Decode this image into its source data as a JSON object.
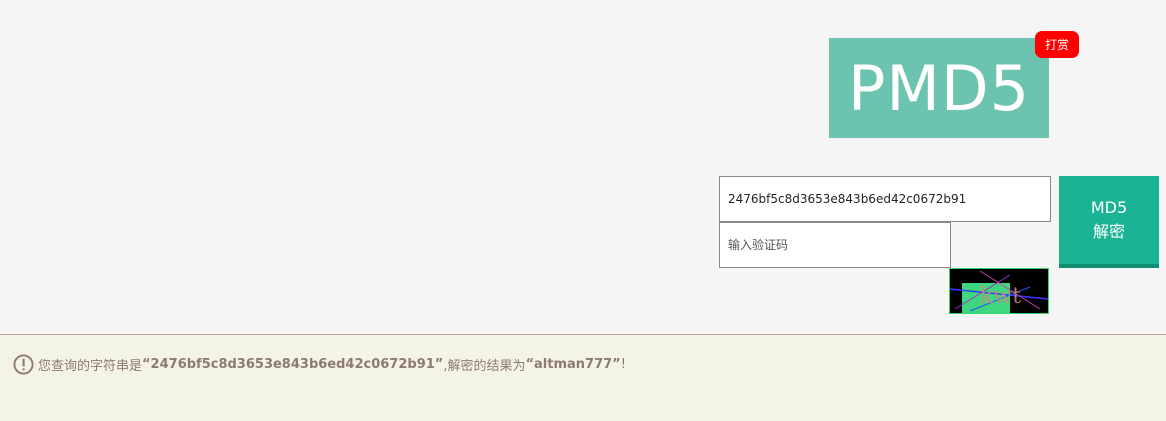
{
  "logo": {
    "text": "PMD5"
  },
  "reward_badge": {
    "label": "打赏"
  },
  "form": {
    "hash_value": "2476bf5c8d3653e843b6ed42c0672b91",
    "captcha_placeholder": "输入验证码",
    "decrypt_button_line1": "MD5",
    "decrypt_button_line2": "解密",
    "captcha_text": "kwt"
  },
  "result": {
    "prefix": "您查询的字符串是",
    "hash_quoted": "“2476bf5c8d3653e843b6ed42c0672b91”",
    "middle": ",解密的结果为",
    "plaintext_quoted": "“altman777”",
    "suffix": "!"
  },
  "colors": {
    "logo_bg": "#6cc4b0",
    "badge_bg": "#ff0000",
    "button_bg": "#1ab394",
    "result_bg": "#f4f3e8",
    "result_text": "#8c7b6e"
  },
  "icons": {
    "result_icon": "exclamation-circle-icon"
  }
}
